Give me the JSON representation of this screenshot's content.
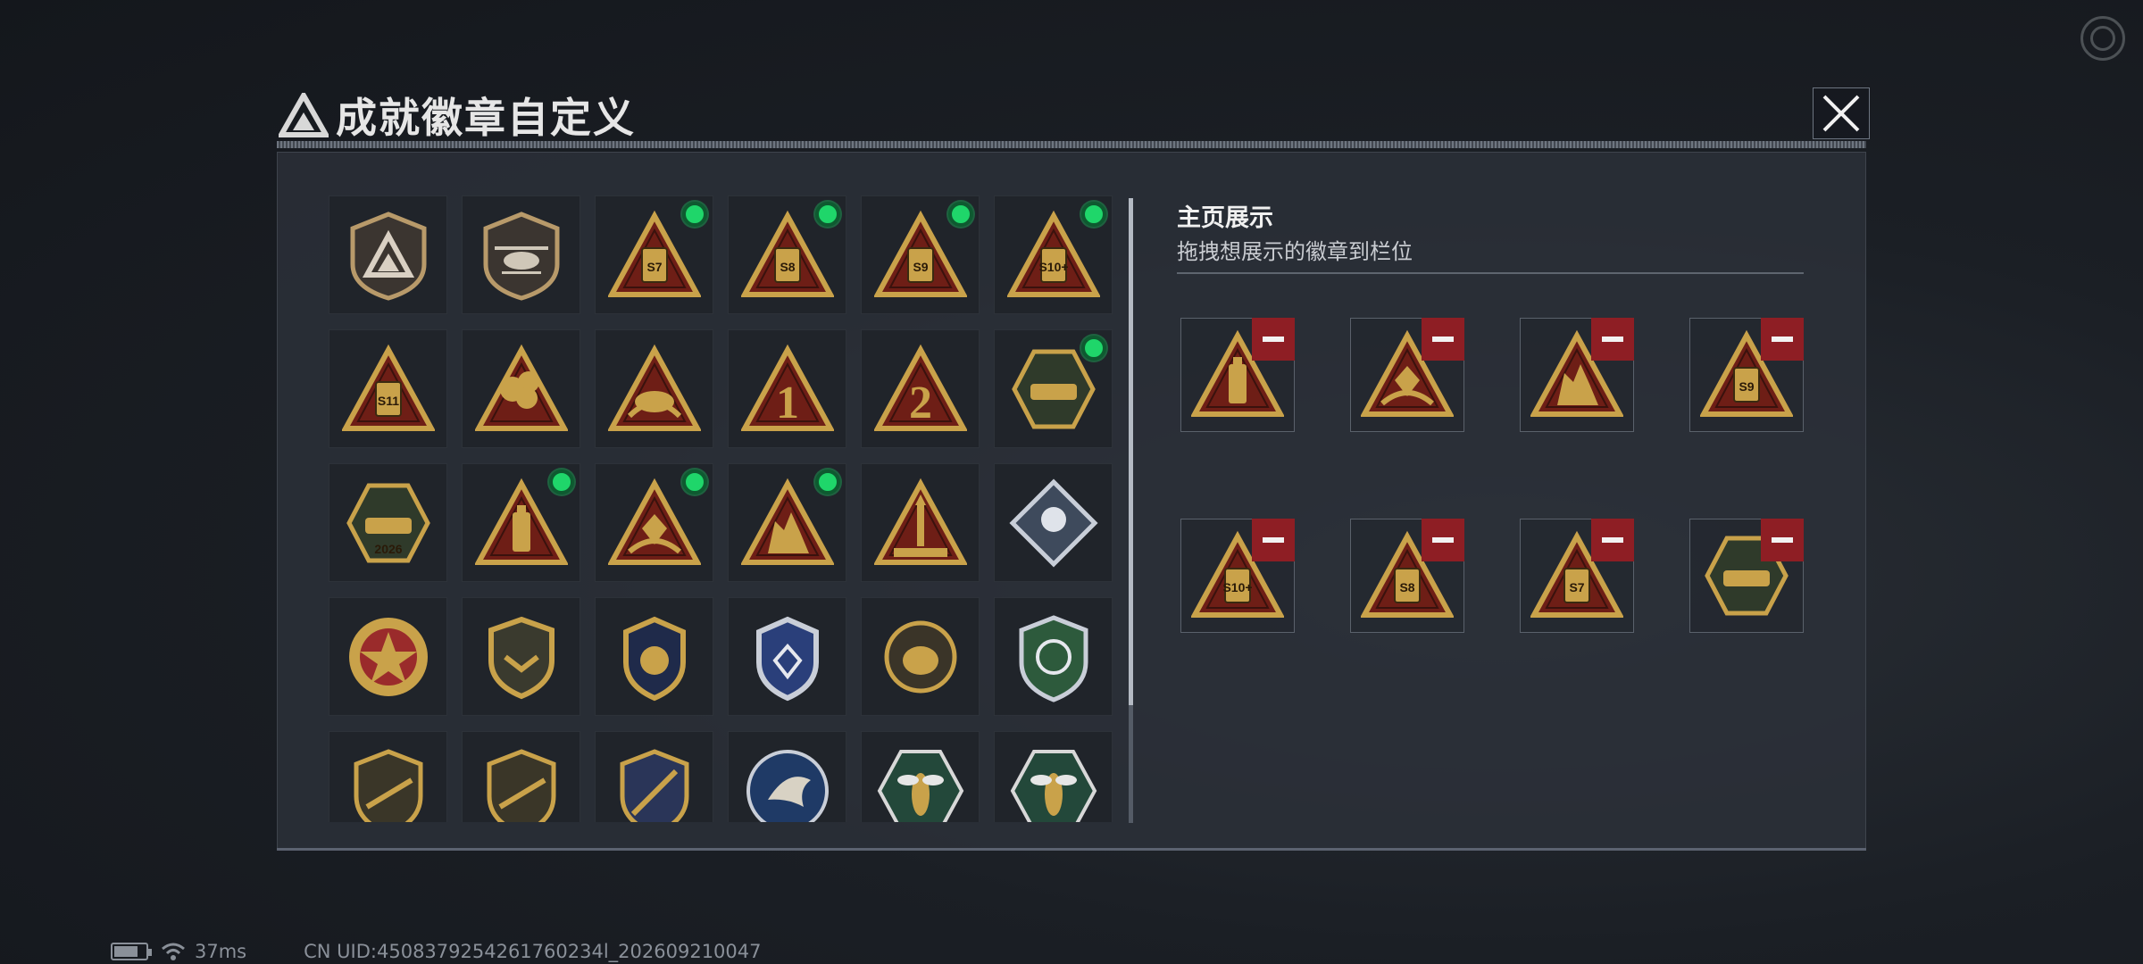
{
  "dialog": {
    "title": "成就徽章自定义"
  },
  "showcase": {
    "title": "主页展示",
    "subtitle": "拖拽想展示的徽章到栏位"
  },
  "badges": [
    {
      "kind": "shield-delta",
      "new": false
    },
    {
      "kind": "helicopter",
      "new": false
    },
    {
      "kind": "season-s7",
      "new": true,
      "label": "S7"
    },
    {
      "kind": "season-s8",
      "new": true,
      "label": "S8"
    },
    {
      "kind": "season-s9",
      "new": true,
      "label": "S9"
    },
    {
      "kind": "season-s10",
      "new": true,
      "label": "S10+"
    },
    {
      "kind": "season-s11",
      "new": false,
      "label": "S11"
    },
    {
      "kind": "explosion",
      "new": false
    },
    {
      "kind": "hands-orb",
      "new": false
    },
    {
      "kind": "rank-1",
      "new": false,
      "label": "1"
    },
    {
      "kind": "rank-2",
      "new": false,
      "label": "2"
    },
    {
      "kind": "delta-force-tank",
      "new": true
    },
    {
      "kind": "delta-force-2026",
      "new": false,
      "label": "2026"
    },
    {
      "kind": "usb-drive",
      "new": true
    },
    {
      "kind": "hands-diamond",
      "new": true
    },
    {
      "kind": "soldiers",
      "new": true
    },
    {
      "kind": "rocket",
      "new": false
    },
    {
      "kind": "diamond-rose",
      "new": false
    },
    {
      "kind": "star-emblem",
      "new": false
    },
    {
      "kind": "chevron-shield",
      "new": false
    },
    {
      "kind": "wing-shield-gold",
      "new": false
    },
    {
      "kind": "wing-shield-blue",
      "new": false
    },
    {
      "kind": "round-skull",
      "new": false
    },
    {
      "kind": "green-rifle-shield",
      "new": false
    },
    {
      "kind": "rifle-badge-a",
      "new": false
    },
    {
      "kind": "rifle-badge-b",
      "new": false
    },
    {
      "kind": "sword-shield",
      "new": false
    },
    {
      "kind": "eagle",
      "new": false
    },
    {
      "kind": "wasp-a",
      "new": false
    },
    {
      "kind": "wasp-b",
      "new": false
    }
  ],
  "slots": [
    {
      "kind": "usb-drive"
    },
    {
      "kind": "hands-diamond"
    },
    {
      "kind": "soldiers"
    },
    {
      "kind": "season-s9",
      "label": "S9"
    },
    {
      "kind": "season-s10",
      "label": "S10+"
    },
    {
      "kind": "season-s8",
      "label": "S8"
    },
    {
      "kind": "season-s7",
      "label": "S7"
    },
    {
      "kind": "delta-force-tank"
    }
  ],
  "status_bar": {
    "ping": "37ms",
    "uid": "CN UID:4508379254261760234l_202609210047"
  },
  "colors": {
    "gold": "#c9a24a",
    "dark_red": "#6e1e16",
    "new_dot": "#1fd66a",
    "remove_red": "#8e1e24"
  }
}
